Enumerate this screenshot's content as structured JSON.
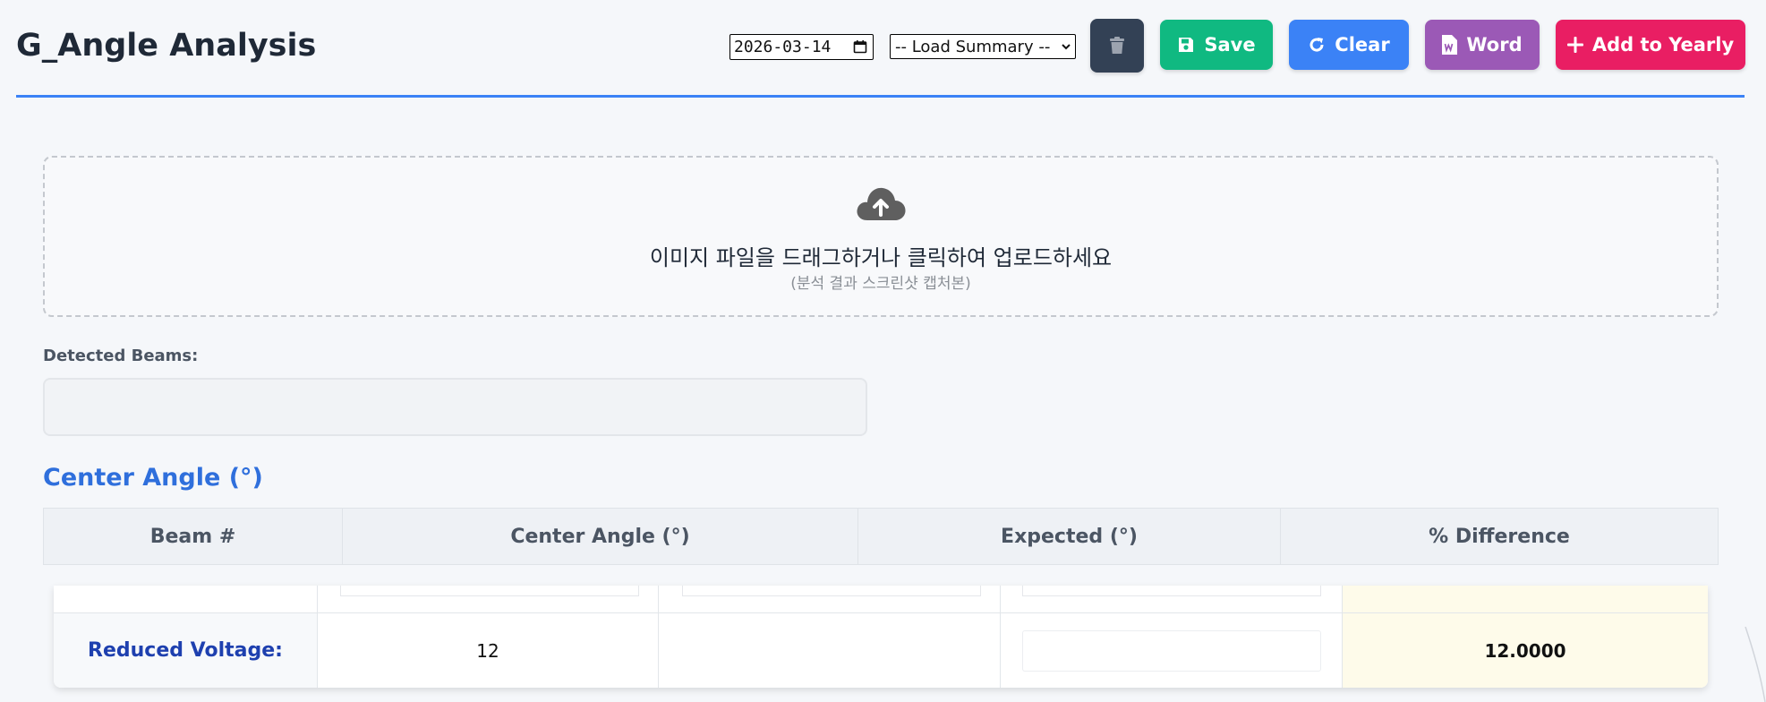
{
  "header": {
    "title": "G_Angle Analysis",
    "date_value": "2026-03-14",
    "summary_select": "-- Load Summary --",
    "buttons": {
      "save": "Save",
      "clear": "Clear",
      "word": "Word",
      "add_yearly": "Add to Yearly"
    }
  },
  "upload": {
    "text": "이미지 파일을 드래그하거나 클릭하여 업로드하세요",
    "subtext": "(분석 결과 스크린샷 캡처본)"
  },
  "beams": {
    "label": "Detected Beams:",
    "value": ""
  },
  "center_angle": {
    "title": "Center Angle (°)",
    "columns": [
      "Beam #",
      "Center Angle (°)",
      "Expected (°)",
      "% Difference"
    ]
  },
  "voltage": {
    "label": "Reduced Voltage:",
    "value": "12",
    "difference": "12.0000"
  },
  "colors": {
    "accent": "#3b82f6",
    "save": "#10b981",
    "clear": "#3b82f6",
    "word": "#9b59b6",
    "add_yearly": "#e91e63",
    "trash": "#334155",
    "section_title": "#2f6fdc",
    "diff_cell": "#fefbea"
  },
  "icons": {
    "trash": "trash-icon",
    "save": "floppy-disk-icon",
    "clear": "rotate-icon",
    "word": "word-file-icon",
    "add_yearly": "plus-icon",
    "upload": "cloud-upload-icon",
    "date": "calendar-icon",
    "select": "chevron-down-icon"
  }
}
